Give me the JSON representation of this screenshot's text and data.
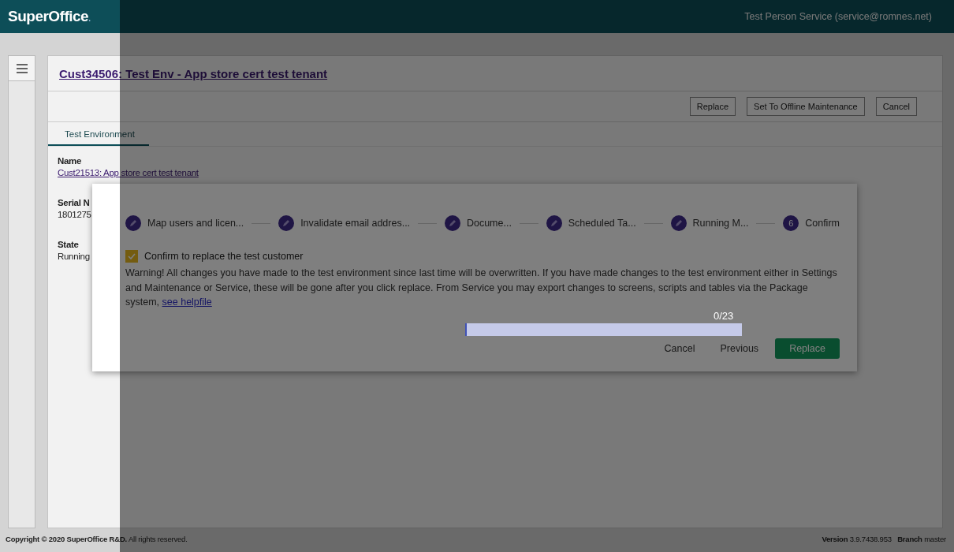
{
  "header": {
    "logo": "SuperOffice",
    "logo_mark": ".",
    "user": "Test Person Service (service@romnes.net)"
  },
  "page": {
    "title": "Cust34506: Test Env - App store cert test tenant",
    "actions": [
      "Replace",
      "Set To Offline Maintenance",
      "Cancel"
    ],
    "tabs": [
      {
        "label": "Test Environment",
        "selected": true
      }
    ],
    "fields": [
      {
        "label": "Name",
        "value": "Cust21513: App store cert test tenant",
        "kind": "link"
      },
      {
        "label": "Serial N",
        "value": "1801275",
        "kind": "text"
      },
      {
        "label": "State",
        "value": "Running",
        "kind": "text"
      }
    ]
  },
  "dialog": {
    "steps": [
      {
        "label": "Map users and licen...",
        "kind": "edited"
      },
      {
        "label": "Invalidate email addres...",
        "kind": "edited"
      },
      {
        "label": "Docume...",
        "kind": "edited"
      },
      {
        "label": "Scheduled Ta...",
        "kind": "edited"
      },
      {
        "label": "Running M...",
        "kind": "edited"
      },
      {
        "label": "Confirm",
        "kind": "current",
        "number": "6"
      }
    ],
    "confirm": {
      "label": "Confirm to replace the test customer",
      "checked": true
    },
    "warning": "Warning! All changes you have made to the test environment since last time will be overwritten. If you have made changes to the test environment either in Settings and Maintenance or Service, these will be gone after you click replace. From Service you may export changes to screens, scripts and tables via the Package system,",
    "help_link": "see helpfile",
    "buttons": [
      {
        "label": "Cancel",
        "kind": "flat"
      },
      {
        "label": "Previous",
        "kind": "flat"
      },
      {
        "label": "Replace",
        "kind": "primary"
      }
    ]
  },
  "progress": {
    "label": "0/23",
    "level": 0
  },
  "footer": {
    "copyright": "Copyright © 2020 SuperOffice R&D.",
    "rights": "All rights reserved.",
    "version_label": "Version",
    "version": "3.9.7438.953",
    "branch_label": "Branch",
    "branch": "master"
  }
}
